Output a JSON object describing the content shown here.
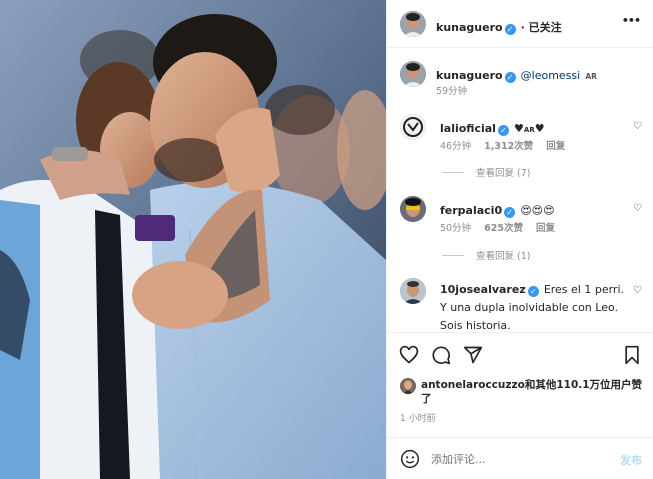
{
  "header": {
    "username": "kunaguero",
    "follow_state": "· 已关注",
    "more": "•••"
  },
  "caption": {
    "username": "kunaguero",
    "mention": "@leomessi",
    "flag": "AR",
    "time": "59分钟"
  },
  "comments": [
    {
      "username": "lalioficial",
      "text_prefix": "♥",
      "text_flag": "AR",
      "text_suffix": "♥",
      "time": "46分钟",
      "likes": "1,312次赞",
      "reply": "回复",
      "view_replies": "查看回复 (7)"
    },
    {
      "username": "ferpalaci0",
      "text": "😍😍😍",
      "time": "50分钟",
      "likes": "625次赞",
      "reply": "回复",
      "view_replies": "查看回复 (1)"
    },
    {
      "username": "10josealvarez",
      "text": "Eres el 1 perri. Y una dupla inolvidable con Leo. Sois historia."
    }
  ],
  "likes_line": {
    "user": "antonelaroccuzzo",
    "rest": "和其他110.1万位用户赞了"
  },
  "post_time": "1 小时前",
  "add_comment": {
    "placeholder": "添加评论...",
    "post_button": "发布"
  },
  "icons": [
    "heart-icon",
    "comment-icon",
    "share-icon",
    "bookmark-icon",
    "emoji-icon",
    "more-icon",
    "verified-icon"
  ],
  "colors": {
    "verified": "#3897f0",
    "muted": "#8e8e8e",
    "post_button_disabled": "#b3dbff",
    "jersey_blue": "#6ca6d9"
  }
}
